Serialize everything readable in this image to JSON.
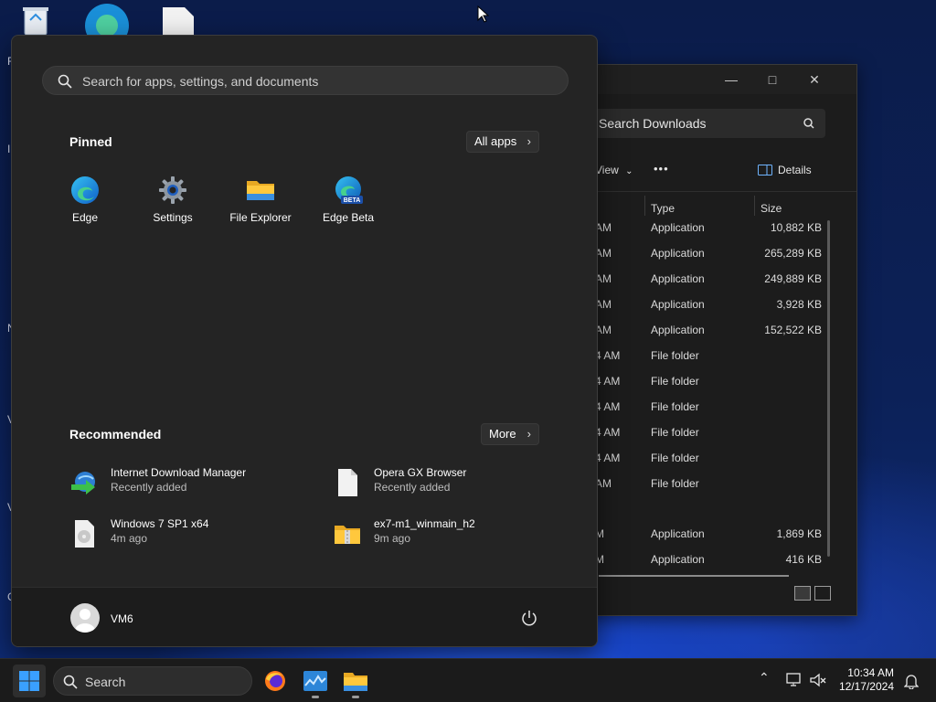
{
  "start_menu": {
    "search_placeholder": "Search for apps, settings, and documents",
    "pinned_title": "Pinned",
    "all_apps_label": "All apps",
    "pinned": [
      {
        "label": "Edge",
        "icon": "edge-icon"
      },
      {
        "label": "Settings",
        "icon": "gear-icon"
      },
      {
        "label": "File Explorer",
        "icon": "folder-icon"
      },
      {
        "label": "Edge Beta",
        "icon": "edge-beta-icon"
      }
    ],
    "edge_beta_badge": "BETA",
    "recommended_title": "Recommended",
    "more_label": "More",
    "recommended": [
      {
        "name": "Internet Download Manager",
        "sub": "Recently added",
        "icon": "idm-icon"
      },
      {
        "name": "Opera GX Browser",
        "sub": "Recently added",
        "icon": "file-icon"
      },
      {
        "name": "Windows 7 SP1 x64",
        "sub": "4m ago",
        "icon": "disc-image-icon"
      },
      {
        "name": "ex7-m1_winmain_h2",
        "sub": "9m ago",
        "icon": "zip-folder-icon"
      }
    ],
    "user_name": "VM6"
  },
  "explorer": {
    "search_placeholder": "Search Downloads",
    "view_label": "View",
    "more_label": "•••",
    "details_label": "Details",
    "columns": {
      "type": "Type",
      "size": "Size"
    },
    "rows": [
      {
        "date": "AM",
        "type": "Application",
        "size": "10,882 KB"
      },
      {
        "date": "AM",
        "type": "Application",
        "size": "265,289 KB"
      },
      {
        "date": "AM",
        "type": "Application",
        "size": "249,889 KB"
      },
      {
        "date": "AM",
        "type": "Application",
        "size": "3,928 KB"
      },
      {
        "date": "AM",
        "type": "Application",
        "size": "152,522 KB"
      },
      {
        "date": "4 AM",
        "type": "File folder",
        "size": ""
      },
      {
        "date": "4 AM",
        "type": "File folder",
        "size": ""
      },
      {
        "date": "4 AM",
        "type": "File folder",
        "size": ""
      },
      {
        "date": "4 AM",
        "type": "File folder",
        "size": ""
      },
      {
        "date": "4 AM",
        "type": "File folder",
        "size": ""
      },
      {
        "date": "AM",
        "type": "File folder",
        "size": ""
      },
      {
        "date": "M",
        "type": "Application",
        "size": "1,869 KB"
      },
      {
        "date": "M",
        "type": "Application",
        "size": "416 KB"
      }
    ]
  },
  "desktop_letters": [
    "R",
    "I",
    "N",
    "V",
    "V",
    "C"
  ],
  "taskbar": {
    "search_label": "Search",
    "time": "10:34 AM",
    "date": "12/17/2024"
  },
  "colors": {
    "accent": "#0078d4",
    "start_bg": "#242424",
    "taskbar_bg": "#1b1b1b"
  }
}
